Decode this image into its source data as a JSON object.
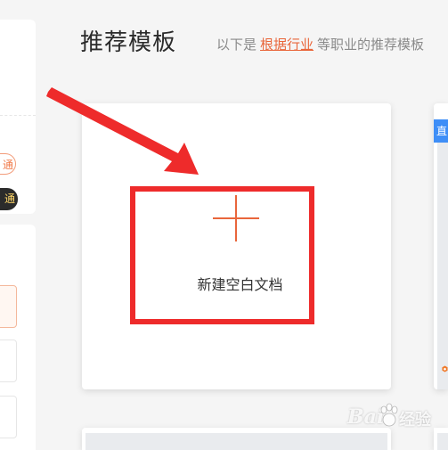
{
  "left_panel": {
    "pill_outline_text": "通",
    "pill_dark_text": "通"
  },
  "header": {
    "title": "推荐模板",
    "desc_prefix": "以下是",
    "desc_link": "根据行业",
    "desc_suffix": "等职业的推荐模板"
  },
  "new_doc_card": {
    "label": "新建空白文档"
  },
  "right_card": {
    "badge_text": "直"
  },
  "watermark": {
    "text_left": "Bai",
    "text_right": "经验"
  },
  "colors": {
    "accent": "#e9663b",
    "highlight_red": "#ee2b2b",
    "badge_blue": "#3e8ef7",
    "pill_dark_bg": "#2b2b2b"
  },
  "icons": {
    "add": "plus-icon",
    "template_tag": "hexagon-icon",
    "watermark_logo": "paw-icon"
  }
}
